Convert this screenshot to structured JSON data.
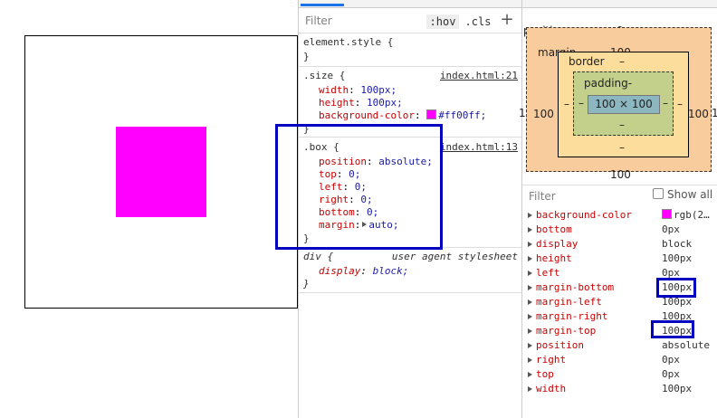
{
  "preview": {
    "square_color": "#ff00ff"
  },
  "styles_pane": {
    "filter_placeholder": "Filter",
    "hov_label": ":hov",
    "cls_label": ".cls",
    "add_label": "+",
    "element_style": {
      "selector": "element.style {",
      "close": "}"
    },
    "size_rule": {
      "selector": ".size {",
      "source": "index.html:21",
      "props": [
        {
          "name": "width",
          "value": "100px;"
        },
        {
          "name": "height",
          "value": "100px;"
        },
        {
          "name": "background-color",
          "value": "#ff00ff;"
        }
      ],
      "close": "}"
    },
    "box_rule": {
      "selector": ".box {",
      "source": "index.html:13",
      "props": [
        {
          "name": "position",
          "value": "absolute;"
        },
        {
          "name": "top",
          "value": "0;"
        },
        {
          "name": "left",
          "value": "0;"
        },
        {
          "name": "right",
          "value": "0;"
        },
        {
          "name": "bottom",
          "value": "0;"
        },
        {
          "name": "margin",
          "value": "auto;"
        }
      ],
      "close": "}"
    },
    "div_rule": {
      "selector": "div {",
      "source": "user agent stylesheet",
      "props": [
        {
          "name": "display",
          "value": "block;"
        }
      ],
      "close": "}"
    }
  },
  "box_model": {
    "position_label": "position",
    "position_value": "0",
    "margin_label": "margin",
    "margin_top": "100",
    "margin_left": "100",
    "margin_right": "100",
    "margin_bottom": "100",
    "border_label": "border",
    "border_top": "–",
    "border_left": "–",
    "border_right": "–",
    "border_bottom": "–",
    "padding_label": "padding-",
    "padding_left": "–",
    "padding_right": "–",
    "padding_bottom": "–",
    "content": "100 × 100",
    "outer_left": "1",
    "outer_right": "1"
  },
  "computed": {
    "filter_placeholder": "Filter",
    "show_all_label": "Show all",
    "rows": [
      {
        "name": "background-color",
        "value": "rgb(2…"
      },
      {
        "name": "bottom",
        "value": "0px"
      },
      {
        "name": "display",
        "value": "block"
      },
      {
        "name": "height",
        "value": "100px"
      },
      {
        "name": "left",
        "value": "0px"
      },
      {
        "name": "margin-bottom",
        "value": "100px"
      },
      {
        "name": "margin-left",
        "value": "100px"
      },
      {
        "name": "margin-right",
        "value": "100px"
      },
      {
        "name": "margin-top",
        "value": "100px"
      },
      {
        "name": "position",
        "value": "absolute"
      },
      {
        "name": "right",
        "value": "0px"
      },
      {
        "name": "top",
        "value": "0px"
      },
      {
        "name": "width",
        "value": "100px"
      }
    ]
  },
  "colors": {
    "annotation": "#0000c0",
    "property_name": "#c80000",
    "accent": "#1a73e8"
  }
}
